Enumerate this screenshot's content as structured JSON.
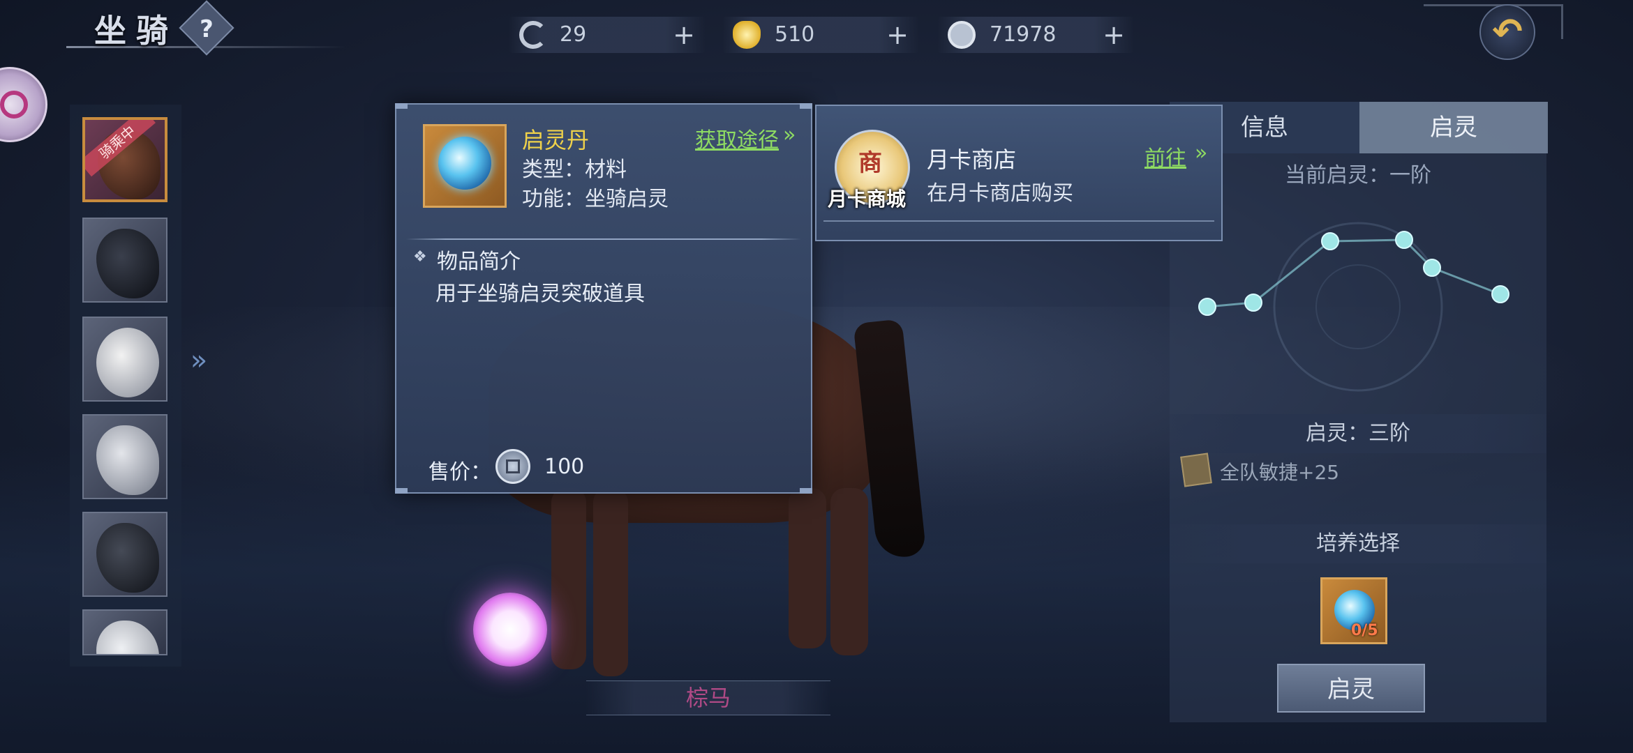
{
  "header": {
    "title": "坐骑",
    "help_icon": "question-icon",
    "resources": [
      {
        "icon": "swirl-currency-icon",
        "value": "29",
        "plus": "+"
      },
      {
        "icon": "gold-ingot-icon",
        "value": "510",
        "plus": "+"
      },
      {
        "icon": "copper-coin-icon",
        "value": "71978",
        "plus": "+"
      }
    ],
    "back_icon": "back-arrow-icon",
    "back_glyph": "↶"
  },
  "mount_list": {
    "riding_badge": "骑乘中",
    "expand_glyph": "»",
    "items": [
      {
        "name": "brown-horse",
        "selected": true
      },
      {
        "name": "black-horse",
        "selected": false
      },
      {
        "name": "white-bear",
        "selected": false
      },
      {
        "name": "white-horse",
        "selected": false
      },
      {
        "name": "dark-horse",
        "selected": false
      },
      {
        "name": "pale-horse",
        "selected": false
      }
    ]
  },
  "mount_name": "棕马",
  "item_popup": {
    "name": "启灵丹",
    "type_line": "类型：材料",
    "func_line": "功能：坐骑启灵",
    "acquire_link": "获取途径",
    "link_arrow": "»",
    "desc_bullet": "❖",
    "desc_title": "物品简介",
    "desc_body": "用于坐骑启灵突破道具",
    "price_label": "售价：",
    "price_value": "100",
    "name_color": "#f0d24a",
    "link_color": "#8edb62"
  },
  "source_popup": {
    "icon_glyph": "商",
    "icon_label": "月卡商城",
    "shop_name": "月卡商店",
    "shop_desc": "在月卡商店购买",
    "go_link": "前往",
    "link_arrow": "»"
  },
  "right_panel": {
    "tabs": [
      {
        "label": "信息",
        "active": false
      },
      {
        "label": "启灵",
        "active": true
      }
    ],
    "current_awaken": "当前启灵：一阶",
    "awaken_level": "启灵：三阶",
    "bonus": "全队敏捷+25",
    "cultivate_title": "培养选择",
    "cultivate_count": "0/5",
    "awaken_button": "启灵"
  }
}
